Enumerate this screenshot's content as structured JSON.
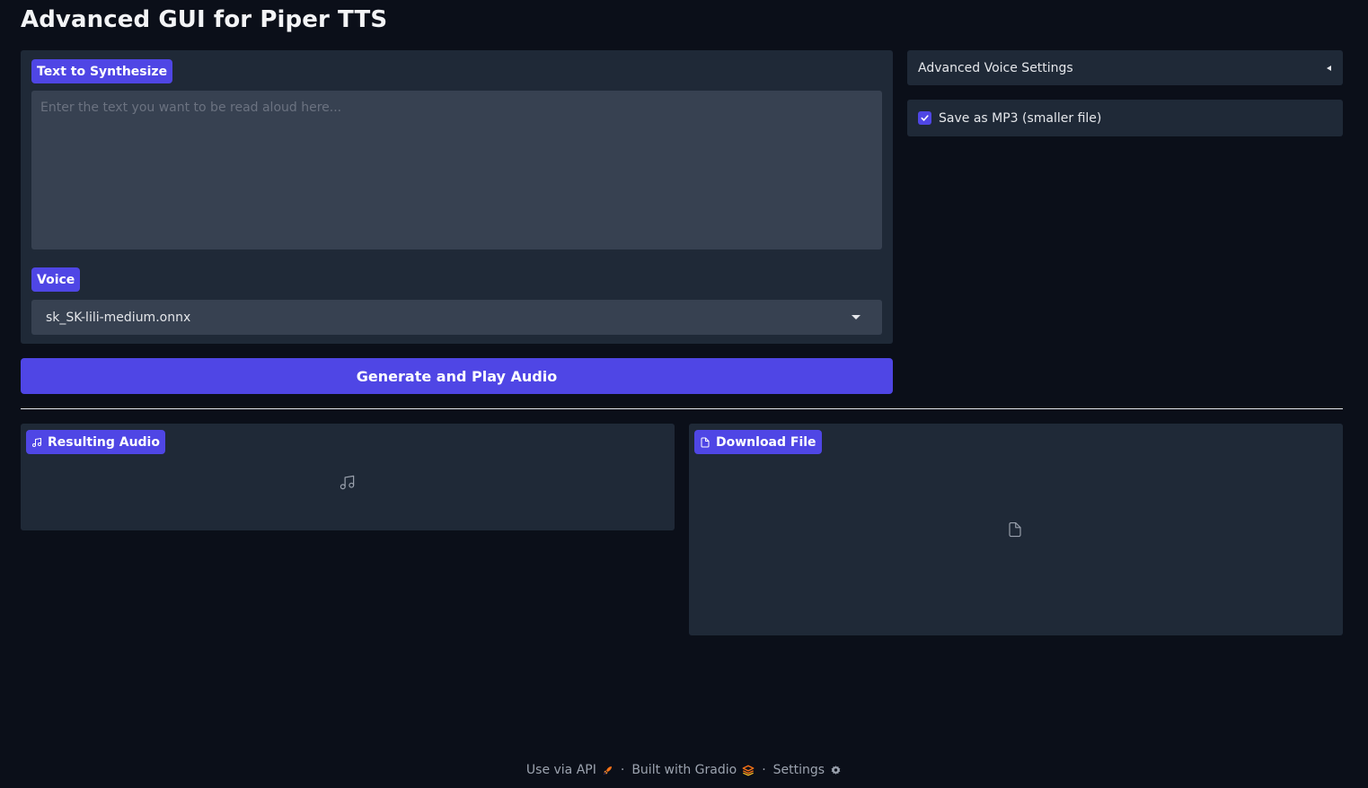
{
  "app": {
    "title": "Advanced GUI for Piper TTS"
  },
  "input": {
    "text_label": "Text to Synthesize",
    "text_placeholder": "Enter the text you want to be read aloud here...",
    "text_value": "",
    "voice_label": "Voice",
    "voice_selected": "sk_SK-lili-medium.onnx"
  },
  "actions": {
    "generate_label": "Generate and Play Audio"
  },
  "settings": {
    "accordion_label": "Advanced Voice Settings",
    "accordion_open": false,
    "mp3_label": "Save as MP3 (smaller file)",
    "mp3_checked": true
  },
  "output": {
    "audio_label": "Resulting Audio",
    "audio_icon": "music-note-icon",
    "file_label": "Download File",
    "file_icon": "file-icon"
  },
  "footer": {
    "api_label": "Use via API",
    "api_icon": "rocket-icon",
    "built_label": "Built with Gradio",
    "built_icon": "gradio-logo-icon",
    "settings_label": "Settings",
    "settings_icon": "gear-icon",
    "separator": "·"
  },
  "colors": {
    "background": "#0b0f19",
    "panel": "#1f2937",
    "input": "#374151",
    "accent": "#4f46e5"
  }
}
